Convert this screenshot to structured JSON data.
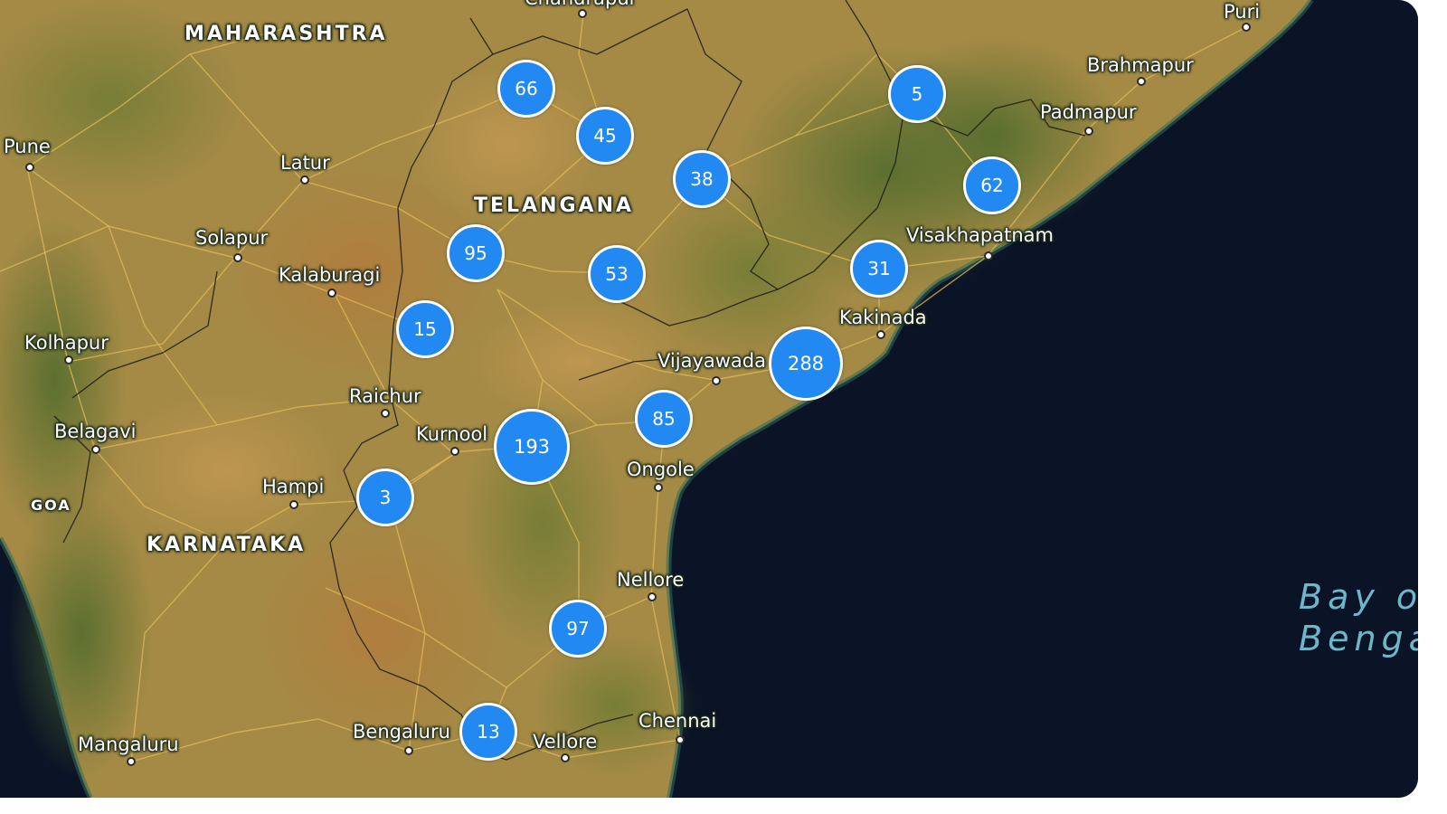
{
  "map": {
    "regions": {
      "maharashtra": "MAHARASHTRA",
      "telangana": "TELANGANA",
      "karnataka": "KARNATAKA",
      "goa": "GOA"
    },
    "water": {
      "line1": "Bay o",
      "line2": "Benga"
    },
    "places": {
      "chandrapur": "Chandrapur",
      "puri": "Puri",
      "brahmapur": "Brahmapur",
      "padmapur": "Padmapur",
      "pune": "Pune",
      "latur": "Latur",
      "solapur": "Solapur",
      "kalaburagi": "Kalaburagi",
      "visakhapatnam": "Visakhapatnam",
      "kakinada": "Kakinada",
      "kolhapur": "Kolhapur",
      "vijayawada": "Vijayawada",
      "raichur": "Raichur",
      "belagavi": "Belagavi",
      "kurnool": "Kurnool",
      "ongole": "Ongole",
      "hampi": "Hampi",
      "nellore": "Nellore",
      "chennai": "Chennai",
      "bengaluru": "Bengaluru",
      "vellore": "Vellore",
      "mangaluru": "Mangaluru"
    },
    "clusters": {
      "c66": "66",
      "c45": "45",
      "c5": "5",
      "c38": "38",
      "c62": "62",
      "c95": "95",
      "c53": "53",
      "c31": "31",
      "c15": "15",
      "c288": "288",
      "c85": "85",
      "c193": "193",
      "c3": "3",
      "c97": "97",
      "c13": "13"
    },
    "colors": {
      "cluster": "#2389f2",
      "sea": "#0b1426",
      "land": "#a48a45"
    }
  }
}
